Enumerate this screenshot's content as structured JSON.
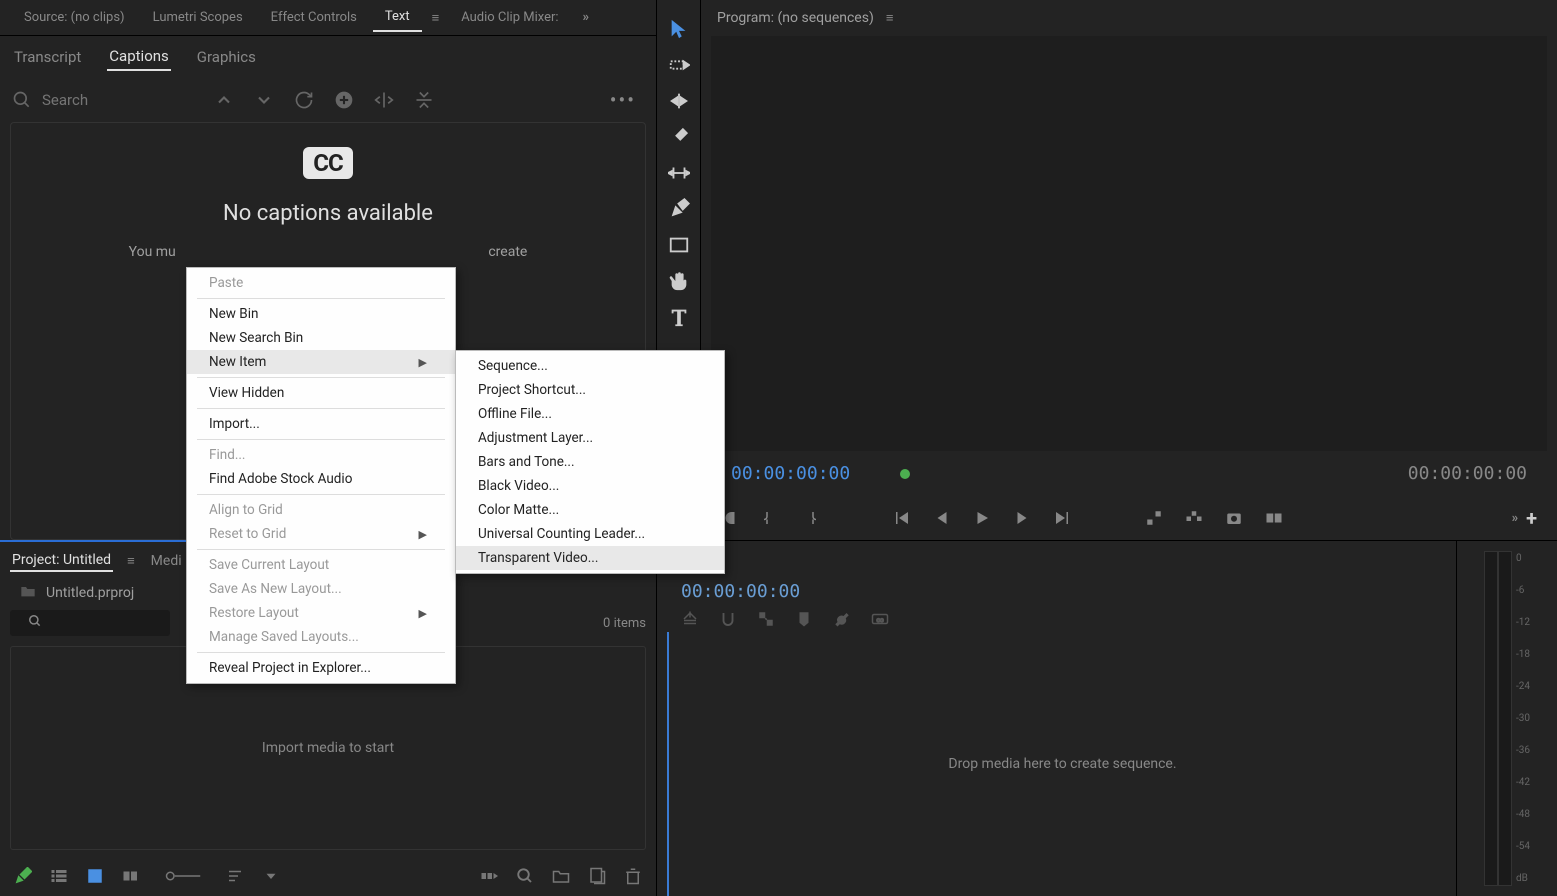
{
  "top_tabs": {
    "source": "Source: (no clips)",
    "lumetri": "Lumetri Scopes",
    "effect": "Effect Controls",
    "text": "Text",
    "audio": "Audio Clip Mixer:"
  },
  "sub_tabs": {
    "transcript": "Transcript",
    "captions": "Captions",
    "graphics": "Graphics"
  },
  "search": {
    "placeholder": "Search"
  },
  "captions": {
    "badge": "CC",
    "title": "No captions available",
    "sub_full": "You must load a sequence in the timeline to create",
    "sub_left": "You mu",
    "sub_right": "create"
  },
  "project": {
    "tab_project": "Project: Untitled",
    "tab_media": "Medi",
    "filename": "Untitled.prproj",
    "items_count": "0 items",
    "import_hint": "Import media to start"
  },
  "program": {
    "title": "Program: (no sequences)",
    "tc_left": "00:00:00:00",
    "tc_right": "00:00:00:00"
  },
  "timeline": {
    "tc": "00:00:00:00",
    "drop_hint": "Drop media here to create sequence."
  },
  "audio_labels": [
    "0",
    "-6",
    "-12",
    "-18",
    "-24",
    "-30",
    "-36",
    "-42",
    "-48",
    "-54",
    "dB"
  ],
  "menu1": [
    {
      "label": "Paste",
      "disabled": true
    },
    {
      "sep": true
    },
    {
      "label": "New Bin"
    },
    {
      "label": "New Search Bin"
    },
    {
      "label": "New Item",
      "arrow": true,
      "hover": true
    },
    {
      "sep": true
    },
    {
      "label": "View Hidden"
    },
    {
      "sep": true
    },
    {
      "label": "Import..."
    },
    {
      "sep": true
    },
    {
      "label": "Find...",
      "disabled": true
    },
    {
      "label": "Find Adobe Stock Audio"
    },
    {
      "sep": true
    },
    {
      "label": "Align to Grid",
      "disabled": true
    },
    {
      "label": "Reset to Grid",
      "disabled": true,
      "arrow": true
    },
    {
      "sep": true
    },
    {
      "label": "Save Current Layout",
      "disabled": true
    },
    {
      "label": "Save As New Layout...",
      "disabled": true
    },
    {
      "label": "Restore Layout",
      "disabled": true,
      "arrow": true
    },
    {
      "label": "Manage Saved Layouts...",
      "disabled": true
    },
    {
      "sep": true
    },
    {
      "label": "Reveal Project in Explorer..."
    }
  ],
  "menu2": [
    {
      "label": "Sequence..."
    },
    {
      "label": "Project Shortcut..."
    },
    {
      "label": "Offline File..."
    },
    {
      "label": "Adjustment Layer..."
    },
    {
      "label": "Bars and Tone..."
    },
    {
      "label": "Black Video..."
    },
    {
      "label": "Color Matte..."
    },
    {
      "label": "Universal Counting Leader..."
    },
    {
      "label": "Transparent Video...",
      "hover": true
    }
  ]
}
